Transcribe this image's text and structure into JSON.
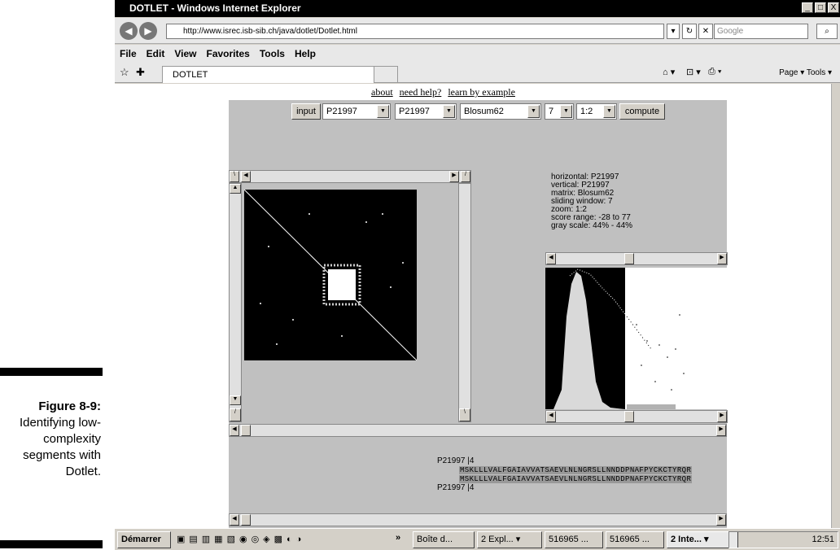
{
  "caption": {
    "figure": "Figure 8-9:",
    "text": "Identifying low-complexity segments with Dotlet."
  },
  "window": {
    "title": "DOTLET - Windows Internet Explorer",
    "minimize": "_",
    "maximize": "□",
    "close": "X"
  },
  "browser": {
    "back": "◀",
    "forward": "▶",
    "address": "http://www.isrec.isb-sib.ch/java/dotlet/Dotlet.html",
    "search_placeholder": "Google",
    "menu": [
      "File",
      "Edit",
      "View",
      "Favorites",
      "Tools",
      "Help"
    ],
    "tab_title": "DOTLET",
    "tools_text": "Page ▾  Tools ▾"
  },
  "page_links": [
    "about",
    "need help?",
    "learn by example"
  ],
  "toolbar": {
    "input_label": "input",
    "seq1": "P21997",
    "seq2": "P21997",
    "matrix": "Blosum62",
    "window": "7",
    "zoom": "1:2",
    "compute_label": "compute"
  },
  "info": [
    "horizontal: P21997",
    "vertical: P21997",
    "matrix: Blosum62",
    "sliding window: 7",
    "zoom: 1:2",
    "score range: -28 to 77",
    "gray scale: 44% - 44%"
  ],
  "alignment": {
    "top_label": "P21997 |4",
    "seq_top": "MSKLLLVALFGAIAVVATSAEVLNLNGRSLLNNDDPNAFPYCKCTYRQR",
    "seq_bottom": "MSKLLLVALFGAIAVVATSAEVLNLNGRSLLNNDDPNAFPYCKCTYRQR",
    "bottom_label": "P21997 |4"
  },
  "taskbar": {
    "start": "Démarrer",
    "tasks": [
      "Boîte d...",
      "2 Expl... ▾",
      "516965 ...",
      "516965 ...",
      "2 Inte... ▾"
    ],
    "clock": "12:51"
  }
}
